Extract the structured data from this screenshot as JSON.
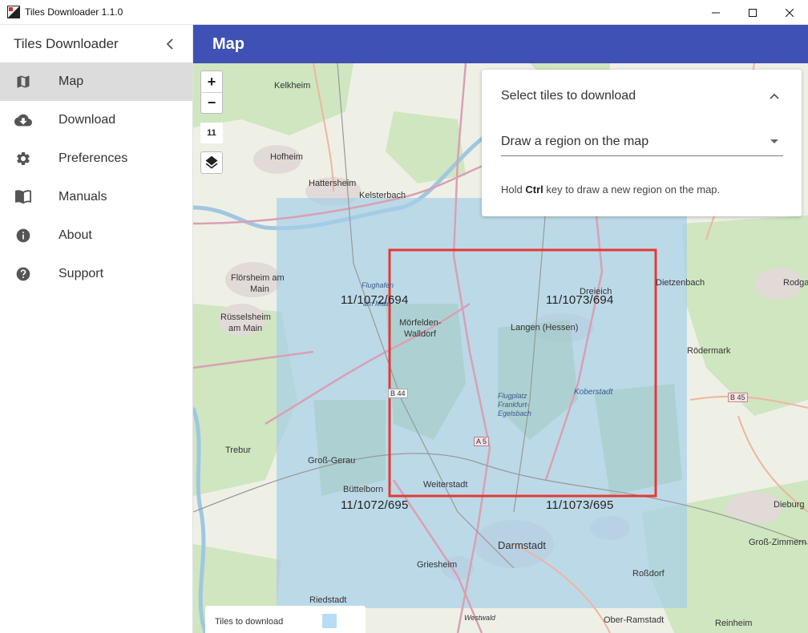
{
  "window": {
    "title": "Tiles Downloader 1.1.0"
  },
  "sidebar": {
    "title": "Tiles Downloader",
    "items": [
      {
        "label": "Map",
        "icon": "map-icon",
        "active": true
      },
      {
        "label": "Download",
        "icon": "cloud-download-icon",
        "active": false
      },
      {
        "label": "Preferences",
        "icon": "gear-icon",
        "active": false
      },
      {
        "label": "Manuals",
        "icon": "book-icon",
        "active": false
      },
      {
        "label": "About",
        "icon": "info-icon",
        "active": false
      },
      {
        "label": "Support",
        "icon": "help-icon",
        "active": false
      }
    ]
  },
  "appbar": {
    "title": "Map",
    "color": "#3f51b5"
  },
  "map": {
    "zoom_in": "+",
    "zoom_out": "−",
    "zoom_level": "11",
    "tiles": [
      {
        "label": "11/1072/694"
      },
      {
        "label": "11/1073/694"
      },
      {
        "label": "11/1072/695"
      },
      {
        "label": "11/1073/695"
      }
    ],
    "places": [
      "Kelkheim",
      "Hofheim",
      "Hattersheim",
      "Kelsterbach",
      "Flörsheim am",
      "Main",
      "Rüsselsheim",
      "am Main",
      "Mörfelden-",
      "Walldorf",
      "Langen (Hessen)",
      "Dreieich",
      "Dietzenbach",
      "Rodgau",
      "Rödermark",
      "Koberstadt",
      "Trebur",
      "Groß-Gerau",
      "Büttelborn",
      "Weiterstadt",
      "Darmstadt",
      "Griesheim",
      "Riedstadt",
      "Roßdorf",
      "Dieburg",
      "Groß-Zimmern",
      "Ober-Ramstadt",
      "Reinheim",
      "Westwald",
      "Flugplatz",
      "Frankfurt-",
      "Egelsbach",
      "Flughafen",
      "am Main",
      "B 44",
      "B 45",
      "A 5"
    ],
    "selection_color": "#e53935",
    "tile_color": "#b7dcf6"
  },
  "panel": {
    "title": "Select tiles to download",
    "select_value": "Draw a region on the map",
    "hint_prefix": "Hold ",
    "hint_key": "Ctrl",
    "hint_suffix": " key to draw a new region on the map."
  },
  "legend": {
    "label": "Tiles to download"
  }
}
